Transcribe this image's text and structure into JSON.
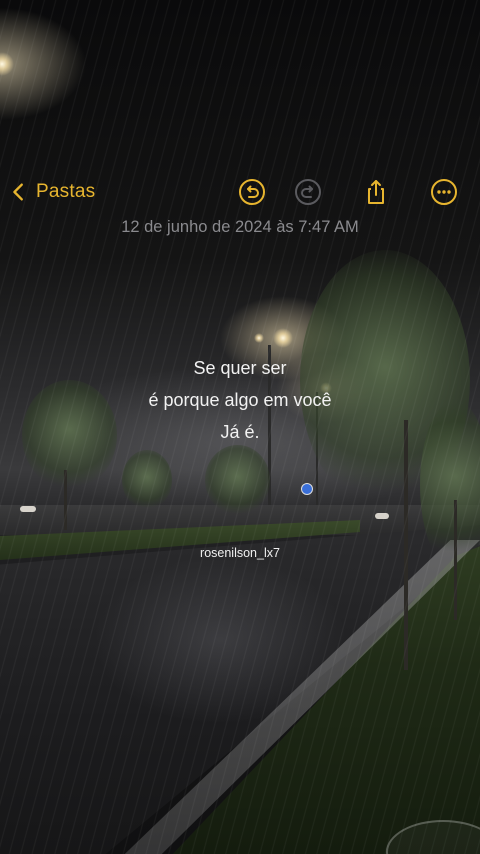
{
  "nav": {
    "back_label": "Pastas",
    "actions": [
      "undo-icon",
      "redo-icon",
      "share-icon",
      "more-icon"
    ]
  },
  "note": {
    "date": "12 de junho de 2024 às 7:47 AM",
    "lines": [
      "Se quer ser",
      "é porque algo em você",
      "Já é."
    ]
  },
  "watermark": "rosenilson_lx7",
  "colors": {
    "accent": "#e7b52f",
    "disabled": "#5a5a5e",
    "date_text": "#8a8a8e",
    "body_text": "#f2f2f2"
  }
}
